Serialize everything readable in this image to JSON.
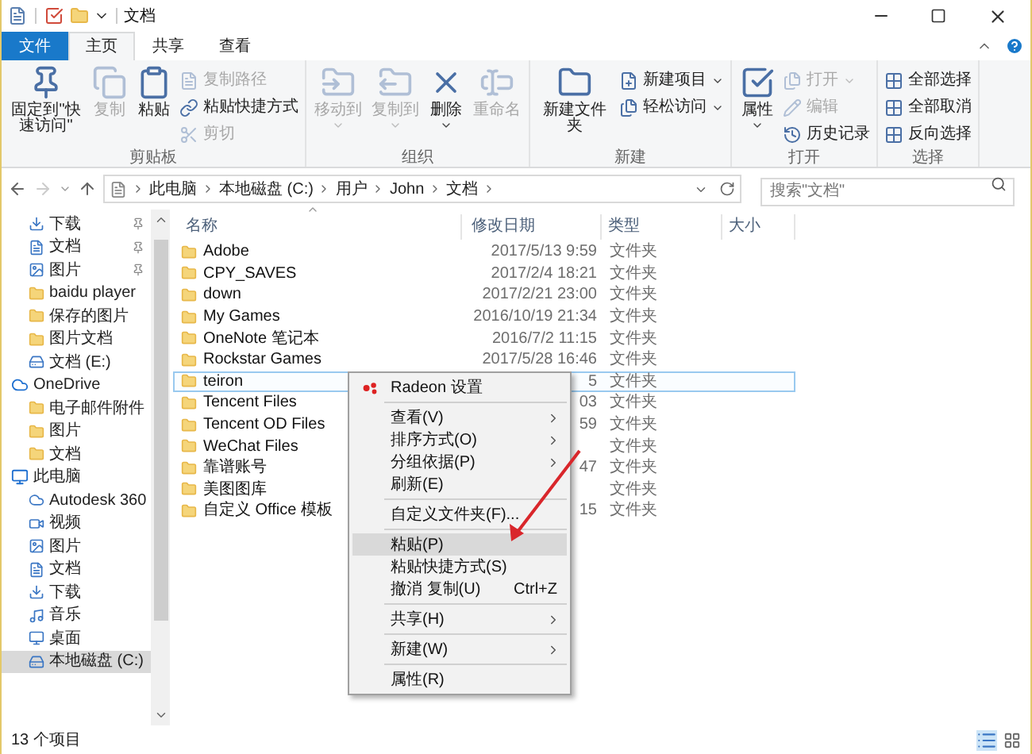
{
  "window": {
    "title": "文档"
  },
  "ribbon_tabs": [
    {
      "label": "文件",
      "kind": "file",
      "selected": false
    },
    {
      "label": "主页",
      "kind": "tab",
      "selected": true
    },
    {
      "label": "共享",
      "kind": "tab",
      "selected": false
    },
    {
      "label": "查看",
      "kind": "tab",
      "selected": false
    }
  ],
  "ribbon_groups": [
    {
      "label": "剪贴板",
      "columns": [
        {
          "kind": "large",
          "items": [
            {
              "label": "固定到\"快速访问\"",
              "disabled": false,
              "dropdown": false
            }
          ]
        },
        {
          "kind": "large",
          "items": [
            {
              "label": "复制",
              "disabled": true,
              "dropdown": false
            }
          ]
        },
        {
          "kind": "large",
          "items": [
            {
              "label": "粘贴",
              "disabled": false,
              "dropdown": false
            }
          ]
        },
        {
          "kind": "small",
          "items": [
            {
              "label": "复制路径",
              "disabled": true,
              "dropdown": false
            },
            {
              "label": "粘贴快捷方式",
              "disabled": false,
              "dropdown": false
            },
            {
              "label": "剪切",
              "disabled": true,
              "dropdown": false
            }
          ]
        }
      ]
    },
    {
      "label": "组织",
      "columns": [
        {
          "kind": "large",
          "items": [
            {
              "label": "移动到",
              "disabled": true,
              "dropdown": true
            }
          ]
        },
        {
          "kind": "large",
          "items": [
            {
              "label": "复制到",
              "disabled": true,
              "dropdown": true
            }
          ]
        },
        {
          "kind": "large",
          "items": [
            {
              "label": "删除",
              "disabled": false,
              "dropdown": true
            }
          ]
        },
        {
          "kind": "large",
          "items": [
            {
              "label": "重命名",
              "disabled": true,
              "dropdown": false
            }
          ]
        }
      ]
    },
    {
      "label": "新建",
      "columns": [
        {
          "kind": "large",
          "items": [
            {
              "label": "新建文件夹",
              "disabled": false,
              "dropdown": false
            }
          ]
        },
        {
          "kind": "small",
          "items": [
            {
              "label": "新建项目",
              "disabled": false,
              "dropdown": true
            },
            {
              "label": "轻松访问",
              "disabled": false,
              "dropdown": true
            }
          ]
        }
      ]
    },
    {
      "label": "打开",
      "columns": [
        {
          "kind": "large",
          "items": [
            {
              "label": "属性",
              "disabled": false,
              "dropdown": true
            }
          ]
        },
        {
          "kind": "small",
          "items": [
            {
              "label": "打开",
              "disabled": true,
              "dropdown": true
            },
            {
              "label": "编辑",
              "disabled": true,
              "dropdown": false
            },
            {
              "label": "历史记录",
              "disabled": false,
              "dropdown": false
            }
          ]
        }
      ]
    },
    {
      "label": "选择",
      "columns": [
        {
          "kind": "small",
          "items": [
            {
              "label": "全部选择",
              "disabled": false,
              "dropdown": false
            },
            {
              "label": "全部取消",
              "disabled": false,
              "dropdown": false
            },
            {
              "label": "反向选择",
              "disabled": false,
              "dropdown": false
            }
          ]
        }
      ]
    }
  ],
  "breadcrumb": [
    "此电脑",
    "本地磁盘 (C:)",
    "用户",
    "John",
    "文档"
  ],
  "search": {
    "placeholder": "搜索\"文档\""
  },
  "sidebar": {
    "sections": [
      {
        "children": [
          {
            "label": "下载",
            "pinned": true,
            "selected": false
          },
          {
            "label": "文档",
            "pinned": true,
            "selected": false
          },
          {
            "label": "图片",
            "pinned": true,
            "selected": false
          },
          {
            "label": "baidu player",
            "pinned": false,
            "selected": false
          },
          {
            "label": "保存的图片",
            "pinned": false,
            "selected": false
          },
          {
            "label": "图片文档",
            "pinned": false,
            "selected": false
          },
          {
            "label": "文档 (E:)",
            "pinned": false,
            "selected": false
          }
        ]
      },
      {
        "label": "OneDrive",
        "children": [
          {
            "label": "电子邮件附件",
            "pinned": false,
            "selected": false
          },
          {
            "label": "图片",
            "pinned": false,
            "selected": false
          },
          {
            "label": "文档",
            "pinned": false,
            "selected": false
          }
        ]
      },
      {
        "label": "此电脑",
        "children": [
          {
            "label": "Autodesk 360",
            "pinned": false,
            "selected": false
          },
          {
            "label": "视频",
            "pinned": false,
            "selected": false
          },
          {
            "label": "图片",
            "pinned": false,
            "selected": false
          },
          {
            "label": "文档",
            "pinned": false,
            "selected": false
          },
          {
            "label": "下载",
            "pinned": false,
            "selected": false
          },
          {
            "label": "音乐",
            "pinned": false,
            "selected": false
          },
          {
            "label": "桌面",
            "pinned": false,
            "selected": false
          },
          {
            "label": "本地磁盘 (C:)",
            "pinned": false,
            "selected": true
          }
        ]
      }
    ]
  },
  "table": {
    "columns": [
      "名称",
      "修改日期",
      "类型",
      "大小"
    ],
    "rows": [
      {
        "name": "Adobe",
        "date": "2017/5/13 9:59",
        "type": "文件夹",
        "selected": false
      },
      {
        "name": "CPY_SAVES",
        "date": "2017/2/4 18:21",
        "type": "文件夹",
        "selected": false
      },
      {
        "name": "down",
        "date": "2017/2/21 23:00",
        "type": "文件夹",
        "selected": false
      },
      {
        "name": "My Games",
        "date": "2016/10/19 21:34",
        "type": "文件夹",
        "selected": false
      },
      {
        "name": "OneNote 笔记本",
        "date": "2016/7/2 11:15",
        "type": "文件夹",
        "selected": false
      },
      {
        "name": "Rockstar Games",
        "date": "2017/5/28 16:46",
        "type": "文件夹",
        "selected": false
      },
      {
        "name": "teiron",
        "date": "5",
        "type": "文件夹",
        "selected": true
      },
      {
        "name": "Tencent Files",
        "date": "03",
        "type": "文件夹",
        "selected": false
      },
      {
        "name": "Tencent OD Files",
        "date": "59",
        "type": "文件夹",
        "selected": false
      },
      {
        "name": "WeChat Files",
        "type": "文件夹",
        "selected": false
      },
      {
        "name": "靠谱账号",
        "date": "47",
        "type": "文件夹",
        "selected": false
      },
      {
        "name": "美图图库",
        "type": "文件夹",
        "selected": false
      },
      {
        "name": "自定义 Office 模板",
        "date": "15",
        "type": "文件夹",
        "selected": false
      }
    ]
  },
  "context_menu": [
    {
      "kind": "icon_item",
      "label": "Radeon 设置",
      "submenu": false,
      "selected": false
    },
    {
      "kind": "separator"
    },
    {
      "kind": "item",
      "label": "查看(V)",
      "submenu": true,
      "selected": false
    },
    {
      "kind": "item",
      "label": "排序方式(O)",
      "submenu": true,
      "selected": false
    },
    {
      "kind": "item",
      "label": "分组依据(P)",
      "submenu": true,
      "selected": false
    },
    {
      "kind": "item",
      "label": "刷新(E)",
      "submenu": false,
      "selected": false
    },
    {
      "kind": "separator"
    },
    {
      "kind": "item",
      "label": "自定义文件夹(F)...",
      "submenu": false,
      "selected": false
    },
    {
      "kind": "separator"
    },
    {
      "kind": "item",
      "label": "粘贴(P)",
      "submenu": false,
      "selected": true
    },
    {
      "kind": "item",
      "label": "粘贴快捷方式(S)",
      "submenu": false,
      "selected": false
    },
    {
      "kind": "item",
      "label": "撤消 复制(U)",
      "shortcut": "Ctrl+Z",
      "submenu": false,
      "selected": false
    },
    {
      "kind": "separator"
    },
    {
      "kind": "item",
      "label": "共享(H)",
      "submenu": true,
      "selected": false
    },
    {
      "kind": "separator"
    },
    {
      "kind": "item",
      "label": "新建(W)",
      "submenu": true,
      "selected": false
    },
    {
      "kind": "separator"
    },
    {
      "kind": "item",
      "label": "属性(R)",
      "submenu": false,
      "selected": false
    }
  ],
  "status_bar": {
    "text": "13 个项目"
  }
}
